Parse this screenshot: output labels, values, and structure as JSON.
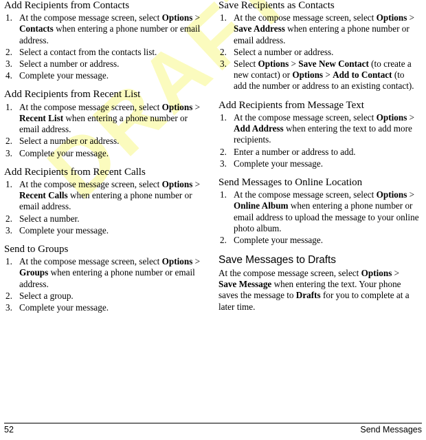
{
  "watermark": {
    "text": "DRAFT",
    "color": "#fbfbbe"
  },
  "footer": {
    "page_number": "52",
    "section": "Send Messages"
  },
  "columns": [
    {
      "name": "left",
      "sections": [
        {
          "level": "h3",
          "heading": "Add Recipients from Contacts",
          "steps": [
            {
              "num": "1.",
              "runs": [
                {
                  "t": "At the compose message screen, select ",
                  "b": false
                },
                {
                  "t": "Options",
                  "b": true
                },
                {
                  "t": " > ",
                  "b": false
                },
                {
                  "t": "Contacts",
                  "b": true
                },
                {
                  "t": " when entering a phone number or email address.",
                  "b": false
                }
              ]
            },
            {
              "num": "2.",
              "runs": [
                {
                  "t": "Select a contact from the contacts list.",
                  "b": false
                }
              ]
            },
            {
              "num": "3.",
              "runs": [
                {
                  "t": "Select a number or address.",
                  "b": false
                }
              ]
            },
            {
              "num": "4.",
              "runs": [
                {
                  "t": "Complete your message.",
                  "b": false
                }
              ]
            }
          ]
        },
        {
          "level": "h3",
          "heading": "Add Recipients from Recent List",
          "steps": [
            {
              "num": "1.",
              "runs": [
                {
                  "t": "At the compose message screen, select ",
                  "b": false
                },
                {
                  "t": "Options",
                  "b": true
                },
                {
                  "t": " > ",
                  "b": false
                },
                {
                  "t": "Recent List",
                  "b": true
                },
                {
                  "t": " when entering a phone number or email address.",
                  "b": false
                }
              ]
            },
            {
              "num": "2.",
              "runs": [
                {
                  "t": "Select a number or address.",
                  "b": false
                }
              ]
            },
            {
              "num": "3.",
              "runs": [
                {
                  "t": "Complete your message.",
                  "b": false
                }
              ]
            }
          ]
        },
        {
          "level": "h3",
          "heading": "Add Recipients from Recent Calls",
          "steps": [
            {
              "num": "1.",
              "runs": [
                {
                  "t": "At the compose message screen, select ",
                  "b": false
                },
                {
                  "t": "Options",
                  "b": true
                },
                {
                  "t": " > ",
                  "b": false
                },
                {
                  "t": "Recent Calls",
                  "b": true
                },
                {
                  "t": " when entering a phone number or email address.",
                  "b": false
                }
              ]
            },
            {
              "num": "2.",
              "runs": [
                {
                  "t": "Select a number.",
                  "b": false
                }
              ]
            },
            {
              "num": "3.",
              "runs": [
                {
                  "t": "Complete your message.",
                  "b": false
                }
              ]
            }
          ]
        },
        {
          "level": "h3",
          "heading": "Send to Groups",
          "steps": [
            {
              "num": "1.",
              "runs": [
                {
                  "t": "At the compose message screen, select ",
                  "b": false
                },
                {
                  "t": "Options",
                  "b": true
                },
                {
                  "t": " > ",
                  "b": false
                },
                {
                  "t": "Groups",
                  "b": true
                },
                {
                  "t": " when entering a phone number or email address.",
                  "b": false
                }
              ]
            },
            {
              "num": "2.",
              "runs": [
                {
                  "t": "Select a group.",
                  "b": false
                }
              ]
            },
            {
              "num": "3.",
              "runs": [
                {
                  "t": "Complete your message.",
                  "b": false
                }
              ]
            }
          ]
        }
      ]
    },
    {
      "name": "right",
      "sections": [
        {
          "level": "h3",
          "heading": "Save Recipients as Contacts",
          "steps": [
            {
              "num": "1.",
              "runs": [
                {
                  "t": "At the compose message screen, select ",
                  "b": false
                },
                {
                  "t": "Options",
                  "b": true
                },
                {
                  "t": " > ",
                  "b": false
                },
                {
                  "t": "Save Address",
                  "b": true
                },
                {
                  "t": " when entering a phone number or email address.",
                  "b": false
                }
              ]
            },
            {
              "num": "2.",
              "runs": [
                {
                  "t": "Select a number or address.",
                  "b": false
                }
              ]
            },
            {
              "num": "3.",
              "runs": [
                {
                  "t": "Select ",
                  "b": false
                },
                {
                  "t": "Options",
                  "b": true
                },
                {
                  "t": " > ",
                  "b": false
                },
                {
                  "t": "Save New Contact",
                  "b": true
                },
                {
                  "t": " (to create a new contact) or ",
                  "b": false
                },
                {
                  "t": "Options",
                  "b": true
                },
                {
                  "t": " > ",
                  "b": false
                },
                {
                  "t": "Add to Contact",
                  "b": true
                },
                {
                  "t": " (to add the number or address to an existing contact).",
                  "b": false
                }
              ]
            }
          ]
        },
        {
          "level": "h3",
          "heading": "Add Recipients from Message Text",
          "steps": [
            {
              "num": "1.",
              "runs": [
                {
                  "t": "At the compose message screen, select ",
                  "b": false
                },
                {
                  "t": "Options",
                  "b": true
                },
                {
                  "t": " > ",
                  "b": false
                },
                {
                  "t": "Add Address",
                  "b": true
                },
                {
                  "t": " when entering the text to add more recipients.",
                  "b": false
                }
              ]
            },
            {
              "num": "2.",
              "runs": [
                {
                  "t": "Enter a number or address to add.",
                  "b": false
                }
              ]
            },
            {
              "num": "3.",
              "runs": [
                {
                  "t": "Complete your message.",
                  "b": false
                }
              ]
            }
          ]
        },
        {
          "level": "h3",
          "heading": "Send Messages to Online Location",
          "steps": [
            {
              "num": "1.",
              "runs": [
                {
                  "t": "At the compose message screen, select ",
                  "b": false
                },
                {
                  "t": "Options",
                  "b": true
                },
                {
                  "t": " > ",
                  "b": false
                },
                {
                  "t": "Online Album",
                  "b": true
                },
                {
                  "t": " when entering a phone number or email address to upload the message to your online photo album.",
                  "b": false
                }
              ]
            },
            {
              "num": "2.",
              "runs": [
                {
                  "t": "Complete your message.",
                  "b": false
                }
              ]
            }
          ]
        },
        {
          "level": "h2",
          "heading": "Save Messages to Drafts",
          "paragraph": [
            {
              "t": "At the compose message screen, select ",
              "b": false
            },
            {
              "t": "Options",
              "b": true
            },
            {
              "t": " > ",
              "b": false
            },
            {
              "t": "Save Message",
              "b": true
            },
            {
              "t": " when entering the text. Your phone saves the message to ",
              "b": false
            },
            {
              "t": "Drafts",
              "b": true
            },
            {
              "t": " for you to complete at a later time.",
              "b": false
            }
          ]
        }
      ]
    }
  ]
}
